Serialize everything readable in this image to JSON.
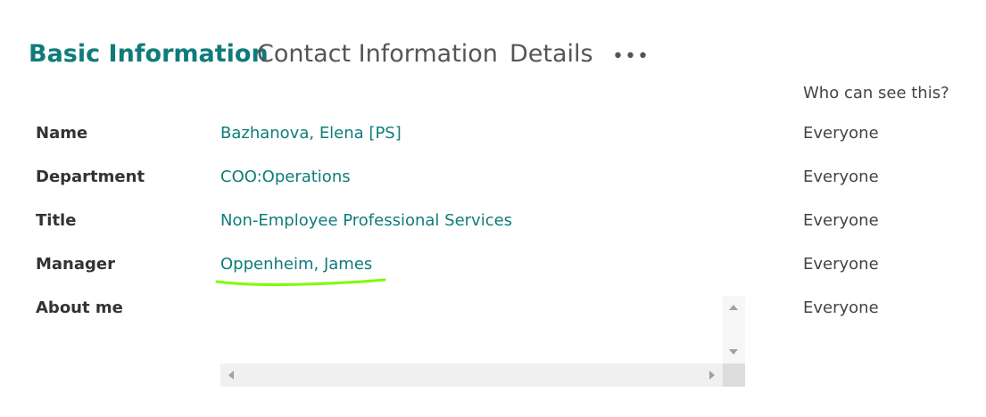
{
  "tabs": {
    "basic": "Basic Information",
    "contact": "Contact Information",
    "details": "Details",
    "more": "..."
  },
  "visibility_header": "Who can see this?",
  "fields": [
    {
      "label": "Name",
      "value": "Bazhanova, Elena [PS]",
      "visibility": "Everyone"
    },
    {
      "label": "Department",
      "value": "COO:Operations",
      "visibility": "Everyone"
    },
    {
      "label": "Title",
      "value": "Non-Employee Professional Services",
      "visibility": "Everyone"
    },
    {
      "label": "Manager",
      "value": "Oppenheim, James",
      "visibility": "Everyone"
    },
    {
      "label": "About me",
      "value": "",
      "visibility": "Everyone"
    }
  ],
  "colors": {
    "accent": "#0f7c7a",
    "highlight": "#7cfc00"
  },
  "icons": {
    "more": "ellipsis-icon",
    "scroll_up": "scroll-up-arrow-icon",
    "scroll_down": "scroll-down-arrow-icon",
    "scroll_left": "scroll-left-arrow-icon",
    "scroll_right": "scroll-right-arrow-icon"
  }
}
